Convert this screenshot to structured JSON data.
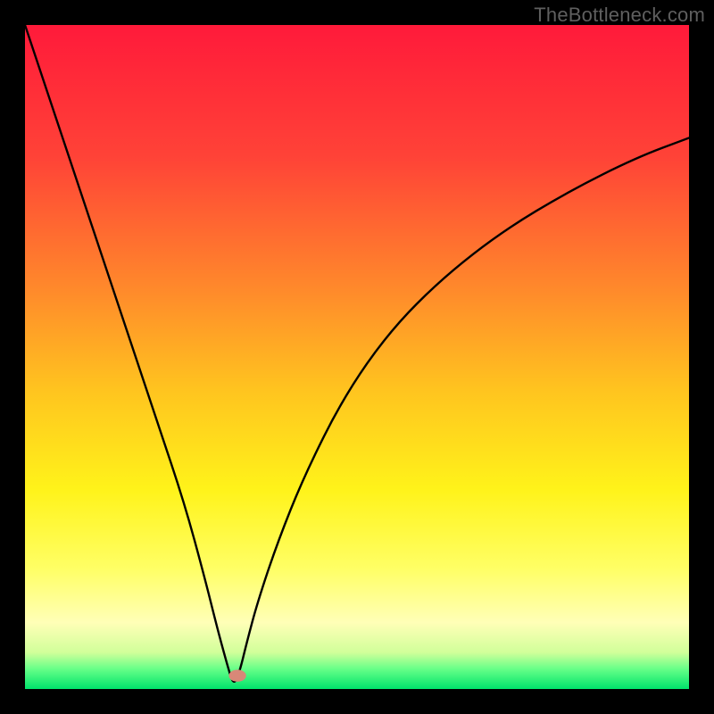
{
  "watermark": "TheBottleneck.com",
  "chart_data": {
    "type": "line",
    "title": "",
    "xlabel": "",
    "ylabel": "",
    "xlim": [
      0,
      100
    ],
    "ylim": [
      0,
      100
    ],
    "gradient_stops": [
      {
        "offset": 0.0,
        "color": "#ff1a3a"
      },
      {
        "offset": 0.2,
        "color": "#ff4337"
      },
      {
        "offset": 0.4,
        "color": "#ff8a2b"
      },
      {
        "offset": 0.55,
        "color": "#ffc41f"
      },
      {
        "offset": 0.7,
        "color": "#fff31a"
      },
      {
        "offset": 0.82,
        "color": "#ffff66"
      },
      {
        "offset": 0.9,
        "color": "#ffffb7"
      },
      {
        "offset": 0.945,
        "color": "#d1ff9a"
      },
      {
        "offset": 0.97,
        "color": "#66ff88"
      },
      {
        "offset": 1.0,
        "color": "#00e36b"
      }
    ],
    "series": [
      {
        "name": "bottleneck-curve",
        "color": "#000000",
        "x": [
          0,
          4,
          8,
          12,
          16,
          20,
          24,
          27,
          29,
          30.5,
          31.4,
          32.3,
          33.4,
          35,
          38,
          42,
          48,
          55,
          63,
          72,
          82,
          92,
          100
        ],
        "values": [
          100,
          88,
          76,
          64,
          52,
          40,
          28,
          17,
          9,
          3.5,
          0.5,
          2.5,
          7,
          13,
          22,
          32,
          44,
          54,
          62,
          69,
          75,
          80,
          83
        ]
      }
    ],
    "marker": {
      "name": "optimal-point",
      "x": 32.0,
      "y": 2.0,
      "rx": 1.3,
      "ry": 0.9,
      "color": "#d88878"
    }
  }
}
